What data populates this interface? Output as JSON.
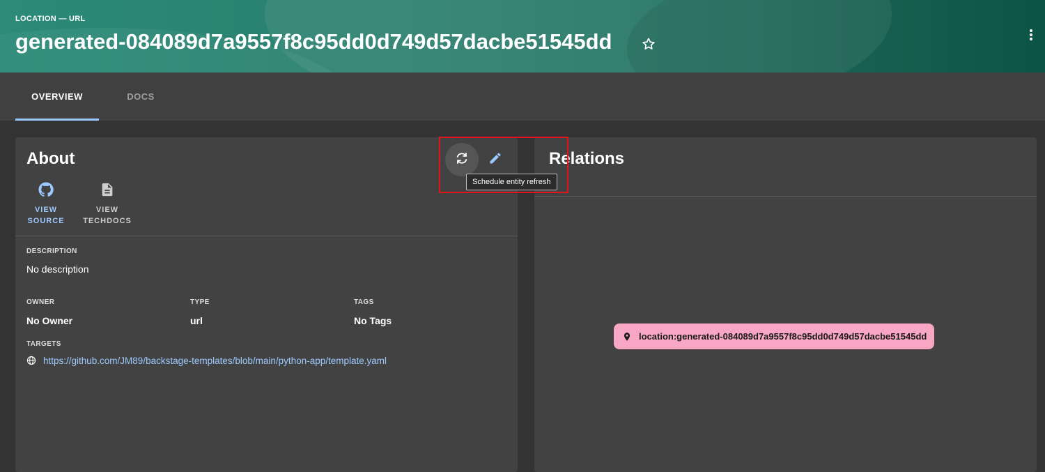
{
  "header": {
    "kind_label": "LOCATION — URL",
    "title": "generated-084089d7a9557f8c95dd0d749d57dacbe51545dd",
    "star_icon": "star-outline-icon",
    "menu_icon": "more-vertical-icon"
  },
  "tabs": [
    {
      "label": "OVERVIEW",
      "selected": true
    },
    {
      "label": "DOCS",
      "selected": false
    }
  ],
  "about": {
    "title": "About",
    "refresh_icon": "refresh-icon",
    "edit_icon": "edit-pencil-icon",
    "tooltip": "Schedule entity refresh",
    "links": [
      {
        "label_line1": "VIEW",
        "label_line2": "SOURCE",
        "icon": "github-icon"
      },
      {
        "label_line1": "VIEW",
        "label_line2": "TECHDOCS",
        "icon": "document-icon"
      }
    ],
    "description_label": "DESCRIPTION",
    "description_value": "No description",
    "owner_label": "OWNER",
    "owner_value": "No Owner",
    "type_label": "TYPE",
    "type_value": "url",
    "tags_label": "TAGS",
    "tags_value": "No Tags",
    "targets_label": "TARGETS",
    "target_url": "https://github.com/JM89/backstage-templates/blob/main/python-app/template.yaml"
  },
  "relations": {
    "title": "Relations",
    "node_label": "location:generated-084089d7a9557f8c95dd0d749d57dacbe51545dd",
    "node_icon": "location-pin-icon"
  },
  "colors": {
    "header_start": "#2b8a78",
    "header_end": "#0e5c4c",
    "link": "#9cc9ff",
    "node": "#f7a6c4",
    "highlight": "#e3141c"
  }
}
